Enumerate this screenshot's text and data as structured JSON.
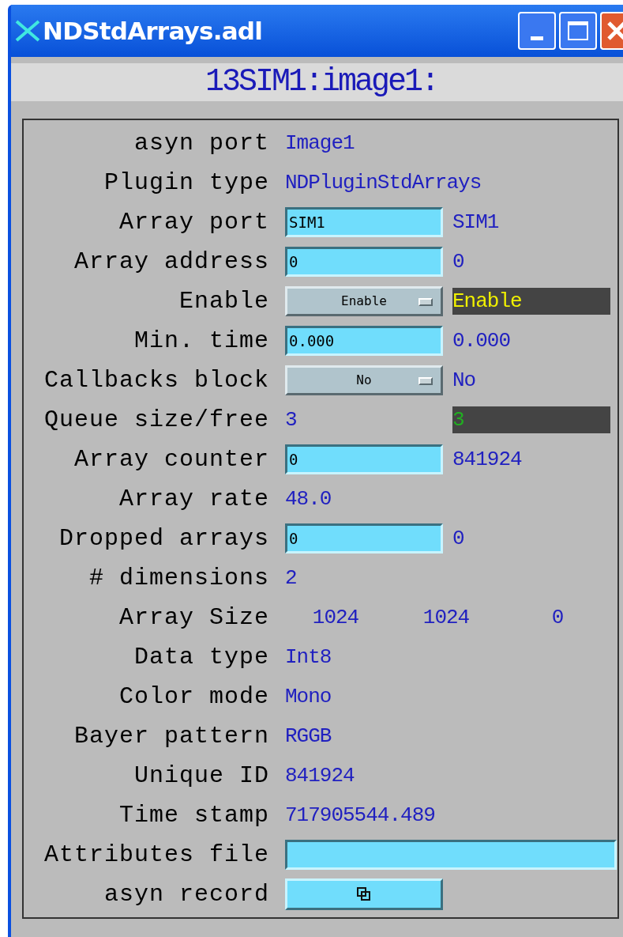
{
  "window": {
    "title": "NDStdArrays.adl"
  },
  "header": "13SIM1:image1:",
  "rows": [
    {
      "kind": "text",
      "label": "asyn port",
      "value": "Image1"
    },
    {
      "kind": "text",
      "label": "Plugin type",
      "value": "NDPluginStdArrays"
    },
    {
      "kind": "input",
      "label": "Array port",
      "value": "SIM1",
      "readback": "SIM1"
    },
    {
      "kind": "input",
      "label": "Array address",
      "value": "0",
      "readback": "0"
    },
    {
      "kind": "menu",
      "label": "Enable",
      "value": "Enable",
      "readback": "Enable",
      "readback_boxed": true
    },
    {
      "kind": "input",
      "label": "Min. time",
      "value": "0.000",
      "readback": "0.000"
    },
    {
      "kind": "menu",
      "label": "Callbacks block",
      "value": "No",
      "readback": "No",
      "readback_boxed": false
    },
    {
      "kind": "pair",
      "label": "Queue size/free",
      "value": "3",
      "readback": "3"
    },
    {
      "kind": "input",
      "label": "Array counter",
      "value": "0",
      "readback": "841924"
    },
    {
      "kind": "text",
      "label": "Array rate",
      "value": "48.0"
    },
    {
      "kind": "input",
      "label": "Dropped arrays",
      "value": "0",
      "readback": "0"
    },
    {
      "kind": "text",
      "label": "# dimensions",
      "value": "2"
    },
    {
      "kind": "array",
      "label": "Array Size",
      "values": [
        "1024",
        "1024",
        "0"
      ]
    },
    {
      "kind": "text",
      "label": "Data type",
      "value": "Int8"
    },
    {
      "kind": "text",
      "label": "Color mode",
      "value": "Mono"
    },
    {
      "kind": "text",
      "label": "Bayer pattern",
      "value": "RGGB"
    },
    {
      "kind": "text",
      "label": "Unique ID",
      "value": "841924"
    },
    {
      "kind": "text",
      "label": "Time stamp",
      "value": "717905544.489"
    },
    {
      "kind": "file",
      "label": "Attributes file"
    },
    {
      "kind": "related",
      "label": "asyn record"
    }
  ]
}
